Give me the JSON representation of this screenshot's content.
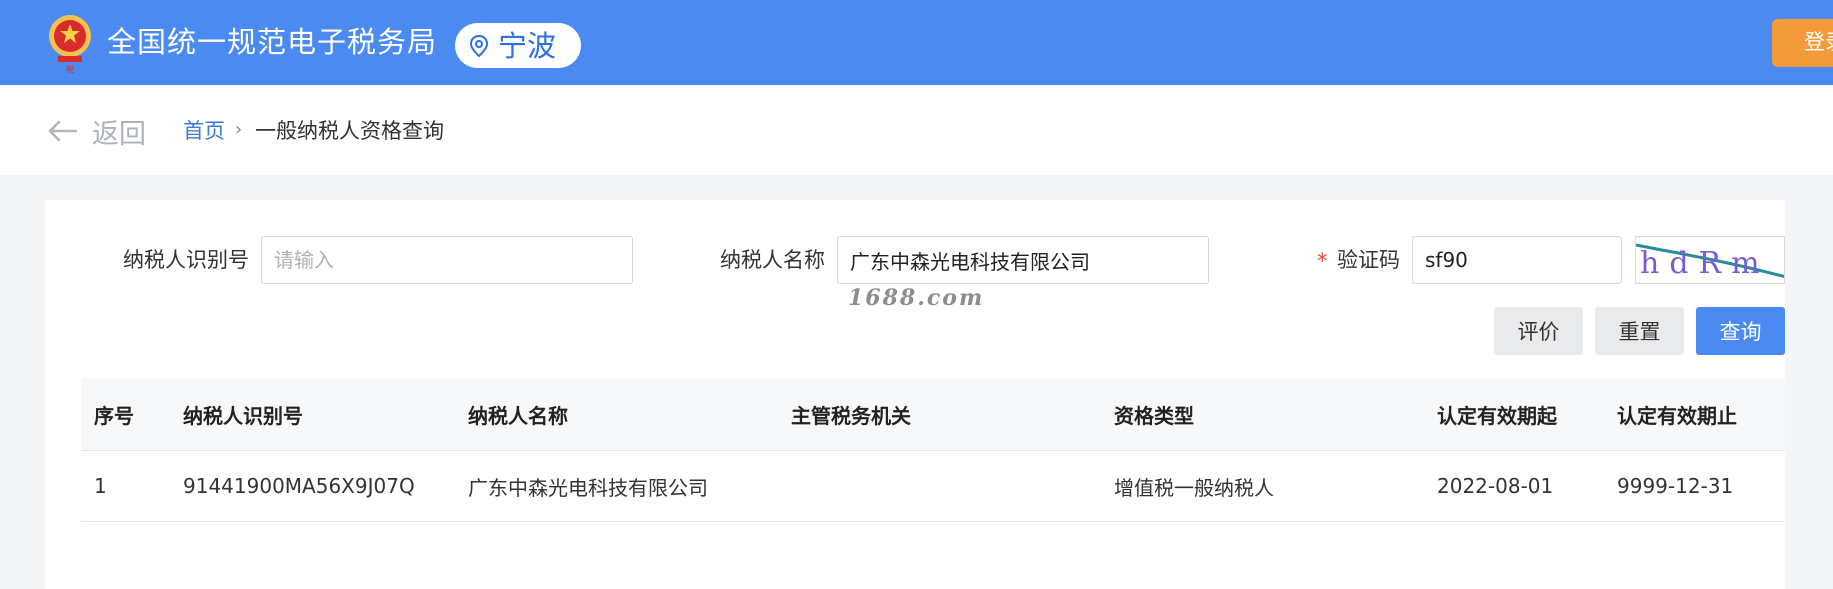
{
  "header": {
    "site_title": "全国统一规范电子税务局",
    "city": "宁波",
    "login_label": "登录",
    "emblem_icon": "national-emblem-icon",
    "location_icon": "map-pin-icon",
    "colors": {
      "bar": "#4b8af1",
      "login": "#f39a3a"
    }
  },
  "breadcrumb": {
    "back_label": "返回",
    "back_icon": "arrow-left-icon",
    "home": "首页",
    "separator": "›",
    "current": "一般纳税人资格查询"
  },
  "form": {
    "taxpayer_id": {
      "label": "纳税人识别号",
      "value": "",
      "placeholder": "请输入"
    },
    "taxpayer_name": {
      "label": "纳税人名称",
      "value": "广东中森光电科技有限公司",
      "placeholder": ""
    },
    "captcha": {
      "label": "验证码",
      "required_mark": "*",
      "value": "sf90",
      "image_text": "hdRm"
    },
    "watermark": "1688.com",
    "buttons": {
      "rate": "评价",
      "reset": "重置",
      "query": "查询"
    }
  },
  "table": {
    "columns": [
      "序号",
      "纳税人识别号",
      "纳税人名称",
      "主管税务机关",
      "资格类型",
      "认定有效期起",
      "认定有效期止"
    ],
    "rows": [
      [
        "1",
        "91441900MA56X9J07Q",
        "广东中森光电科技有限公司",
        "",
        "增值税一般纳税人",
        "2022-08-01",
        "9999-12-31"
      ]
    ]
  }
}
